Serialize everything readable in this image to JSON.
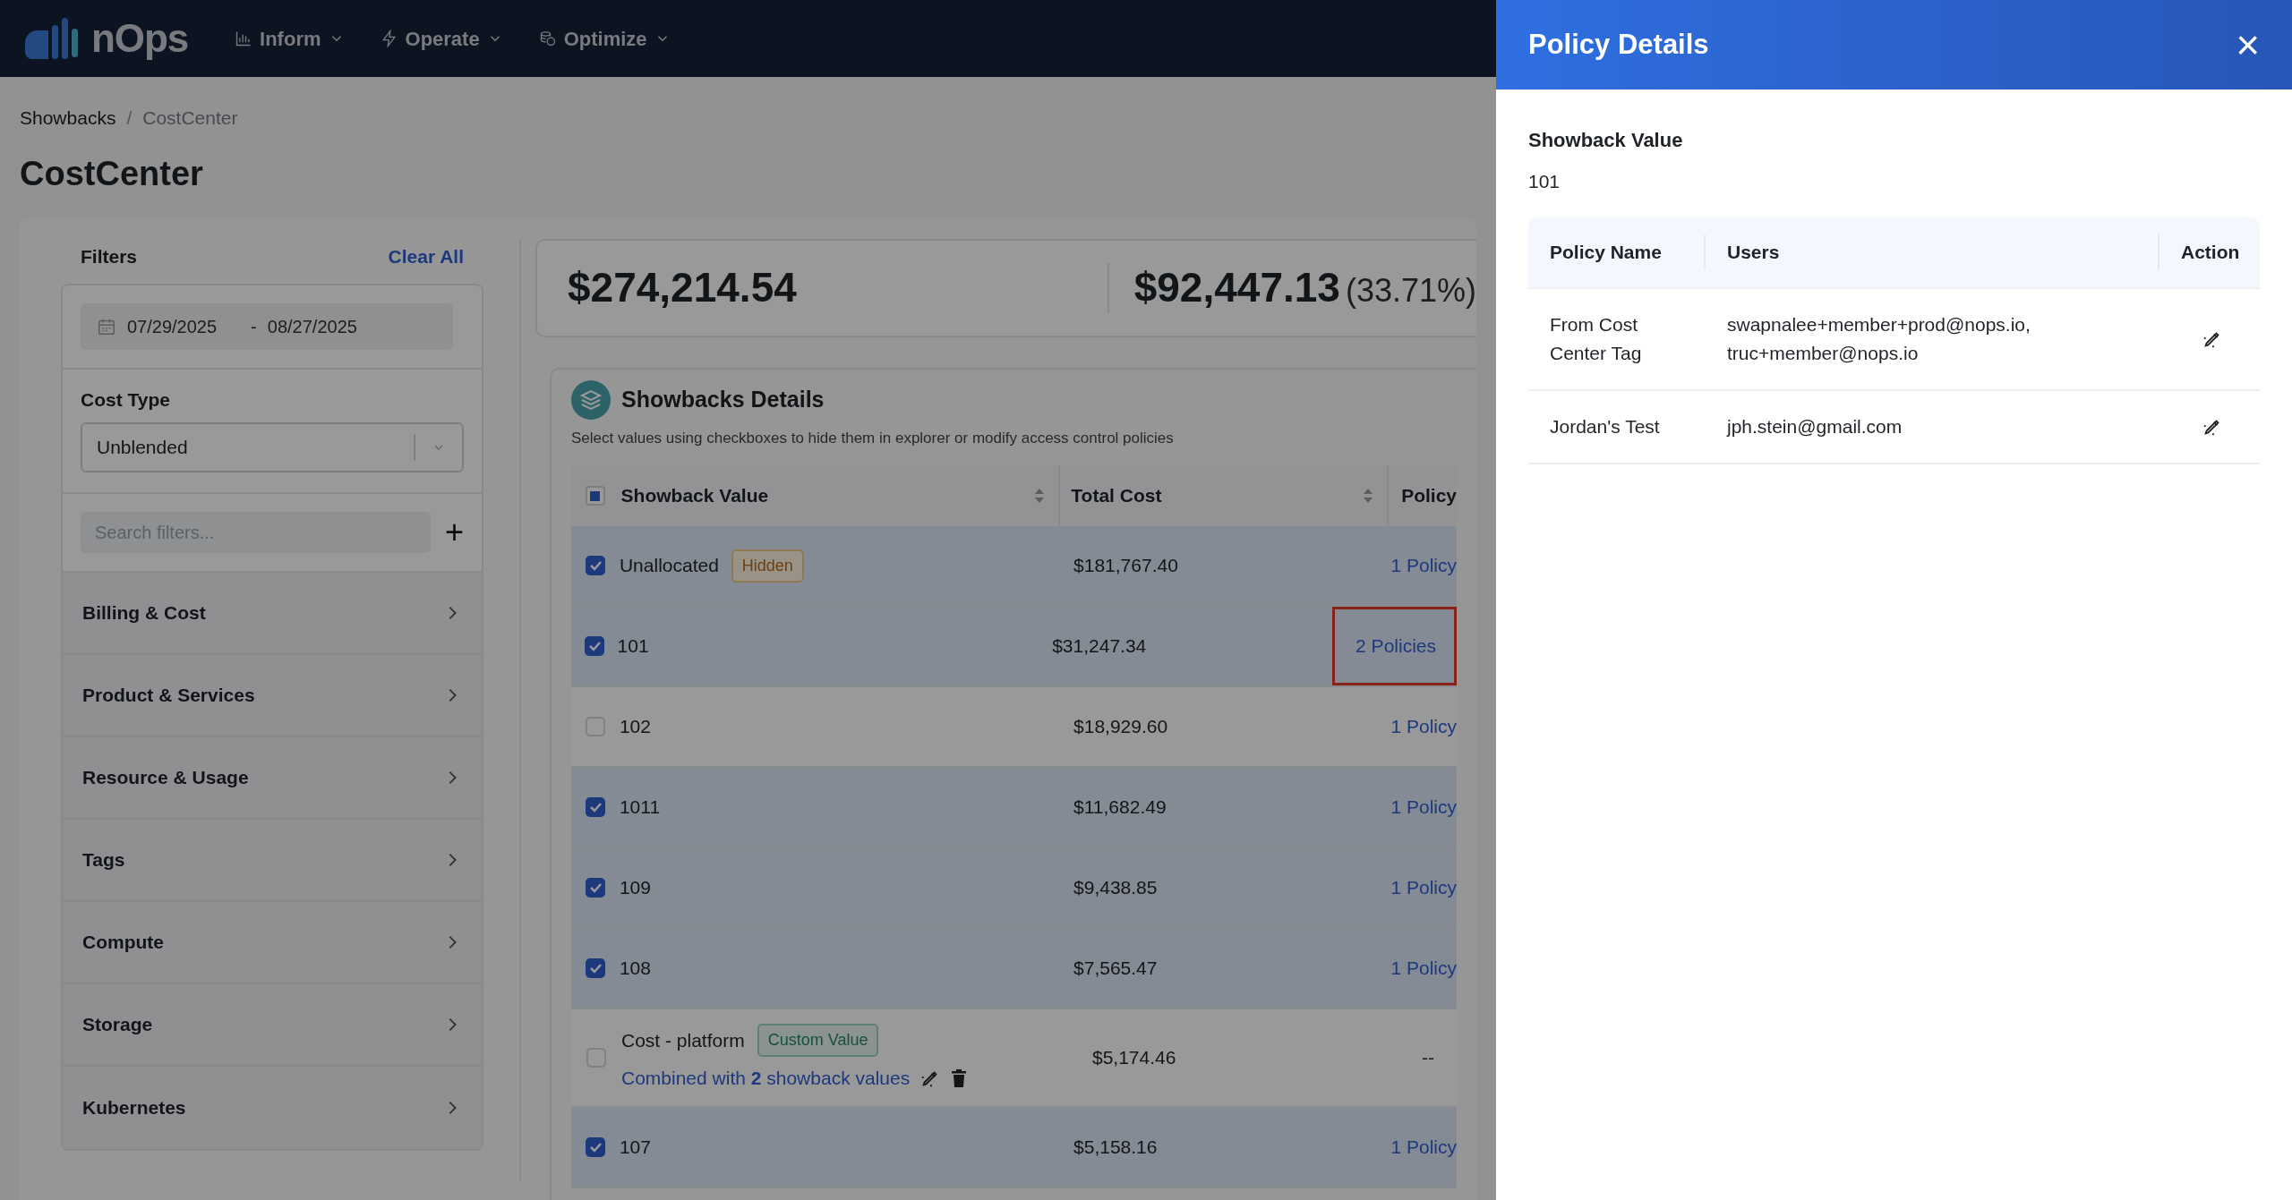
{
  "nav": {
    "logo": "nOps",
    "menus": [
      {
        "label": "Inform"
      },
      {
        "label": "Operate"
      },
      {
        "label": "Optimize"
      }
    ]
  },
  "breadcrumb": [
    {
      "label": "Showbacks",
      "current": false
    },
    {
      "label": "CostCenter",
      "current": true
    }
  ],
  "breadcrumb_separator": "/",
  "page_title": "CostCenter",
  "filters": {
    "title": "Filters",
    "clear": "Clear All",
    "date_from": "07/29/2025",
    "date_sep": "-",
    "date_to": "08/27/2025",
    "cost_type_label": "Cost Type",
    "cost_type_value": "Unblended",
    "search_placeholder": "Search filters...",
    "add": "+",
    "sections": [
      "Billing & Cost",
      "Product & Services",
      "Resource & Usage",
      "Tags",
      "Compute",
      "Storage",
      "Kubernetes"
    ]
  },
  "summary": {
    "total": "$274,214.54",
    "allocated": "$92,447.13",
    "allocated_share": "(33.71%)"
  },
  "details": {
    "title": "Showbacks Details",
    "subtitle": "Select values using checkboxes to hide them in explorer or modify access control policies",
    "header_checkbox_indeterminate": true,
    "columns": [
      "Showback Value",
      "Total Cost",
      "Policy"
    ],
    "rows": [
      {
        "value": "Unallocated",
        "checked": true,
        "badge": {
          "label": "Hidden",
          "kind": "warning"
        },
        "cost": "$181,767.40",
        "policy": "1 Policy",
        "highlighted": false
      },
      {
        "value": "101",
        "checked": true,
        "cost": "$31,247.34",
        "policy": "2 Policies",
        "highlighted": true
      },
      {
        "value": "102",
        "checked": false,
        "cost": "$18,929.60",
        "policy": "1 Policy",
        "highlighted": false
      },
      {
        "value": "1011",
        "checked": true,
        "cost": "$11,682.49",
        "policy": "1 Policy",
        "highlighted": false
      },
      {
        "value": "109",
        "checked": true,
        "cost": "$9,438.85",
        "policy": "1 Policy",
        "highlighted": false
      },
      {
        "value": "108",
        "checked": true,
        "cost": "$7,565.47",
        "policy": "1 Policy",
        "highlighted": false
      },
      {
        "value": "Cost - platform",
        "checked": false,
        "badge": {
          "label": "Custom Value",
          "kind": "custom"
        },
        "combined": "Combined with **2** showback values",
        "cost": "$5,174.46",
        "policy": "--",
        "highlighted": false
      },
      {
        "value": "107",
        "checked": true,
        "cost": "$5,158.16",
        "policy": "1 Policy",
        "highlighted": false
      }
    ]
  },
  "drawer": {
    "title": "Policy Details",
    "close": "×",
    "field_label": "Showback Value",
    "field_value": "101",
    "columns": [
      "Policy Name",
      "Users",
      "Action"
    ],
    "rows": [
      {
        "name": "From Cost Center Tag",
        "users": [
          "swapnalee+member+prod@nops.io,",
          "truc+member@nops.io"
        ]
      },
      {
        "name": "Jordan's Test",
        "users": [
          "jph.stein@gmail.com"
        ]
      }
    ]
  }
}
